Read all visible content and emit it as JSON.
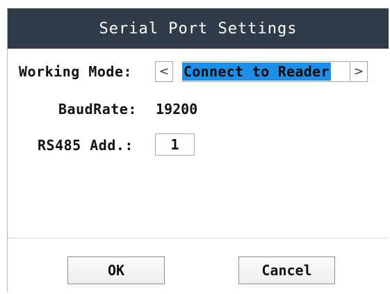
{
  "dialog": {
    "title": "Serial Port Settings"
  },
  "working_mode": {
    "label": "Working Mode:",
    "prev_icon": "chevron-left-icon",
    "prev_glyph": "<",
    "value": "Connect to Reader",
    "next_icon": "chevron-right-icon",
    "next_glyph": ">"
  },
  "baud_rate": {
    "label": "BaudRate:",
    "value": "19200"
  },
  "rs485": {
    "label": "RS485 Add.:",
    "value": "1"
  },
  "buttons": {
    "ok_label": "OK",
    "cancel_label": "Cancel"
  },
  "colors": {
    "title_bar": "#2f3b48",
    "selection": "#1e8fe8"
  }
}
